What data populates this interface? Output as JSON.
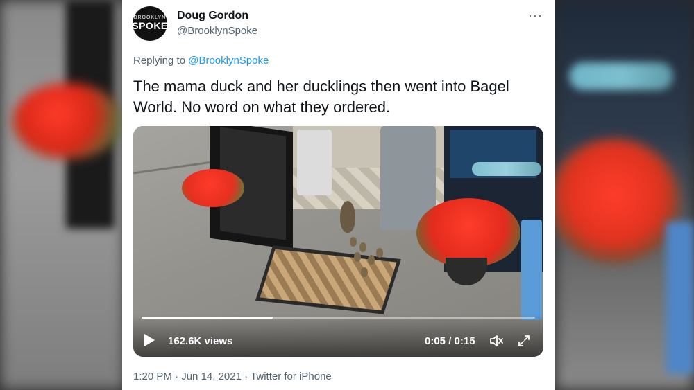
{
  "author": {
    "name": "Doug Gordon",
    "handle": "@BrooklynSpoke",
    "avatar_top_text": "BROOKLYN",
    "avatar_text": "SPOKE"
  },
  "more_icon": "ellipsis-icon",
  "reply": {
    "prefix": "Replying to",
    "mention": "@BrooklynSpoke"
  },
  "tweet": {
    "text": "The mama duck and her ducklings then went into Bagel World. No word on what they ordered."
  },
  "video": {
    "views": "162.6K views",
    "time": "0:05 / 0:15",
    "progress": 0.333,
    "icons": {
      "play": "play-icon",
      "volume": "volume-icon",
      "fullscreen": "fullscreen-icon"
    }
  },
  "meta": {
    "time": "1:20 PM",
    "date": "Jun 14, 2021",
    "source": "Twitter for iPhone",
    "separator": "·"
  },
  "colors": {
    "link": "#1d9bf0",
    "text": "#0f1419",
    "muted": "#536471"
  }
}
